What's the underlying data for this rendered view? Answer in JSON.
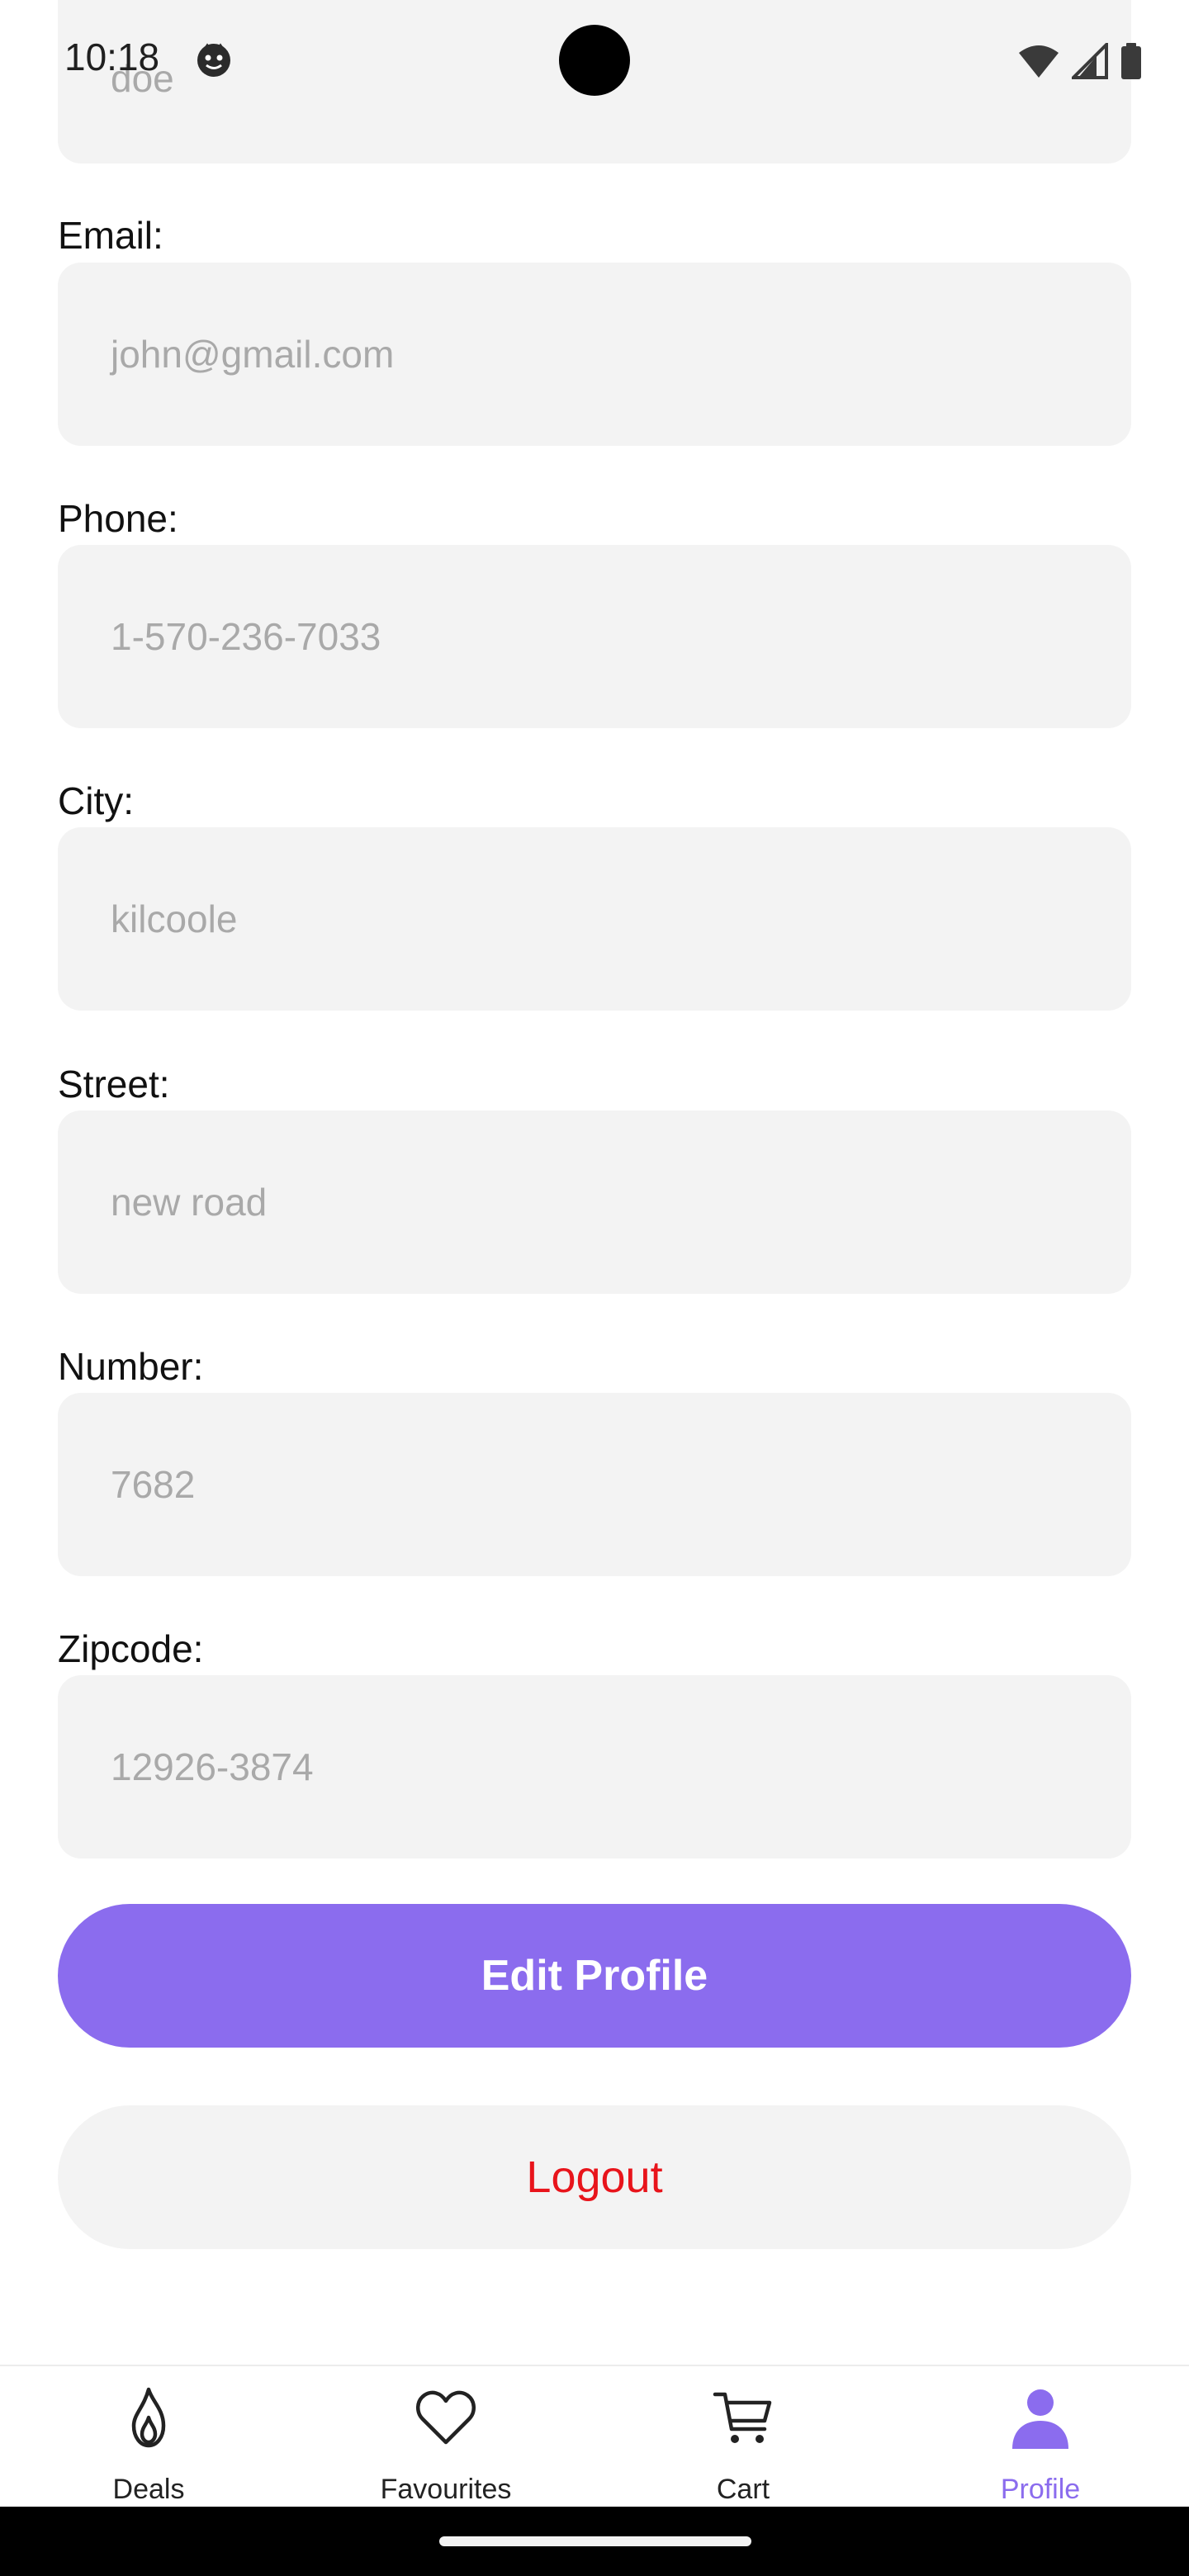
{
  "status_bar": {
    "time": "10:18"
  },
  "form": {
    "last_name_value": "doe",
    "fields": [
      {
        "label": "Email:",
        "value": "john@gmail.com"
      },
      {
        "label": "Phone:",
        "value": "1-570-236-7033"
      },
      {
        "label": "City:",
        "value": "kilcoole"
      },
      {
        "label": "Street:",
        "value": "new road"
      },
      {
        "label": "Number:",
        "value": "7682"
      },
      {
        "label": "Zipcode:",
        "value": "12926-3874"
      }
    ]
  },
  "actions": {
    "edit_label": "Edit Profile",
    "logout_label": "Logout"
  },
  "bottom_nav": {
    "items": [
      {
        "label": "Deals",
        "icon": "flame-icon"
      },
      {
        "label": "Favourites",
        "icon": "heart-icon"
      },
      {
        "label": "Cart",
        "icon": "cart-icon"
      },
      {
        "label": "Profile",
        "icon": "person-icon"
      }
    ],
    "active": "Profile"
  },
  "colors": {
    "accent": "#8b6cee",
    "logout_text": "#e8141b",
    "field_bg": "#f3f3f3",
    "placeholder_text": "#a9a9a9"
  }
}
